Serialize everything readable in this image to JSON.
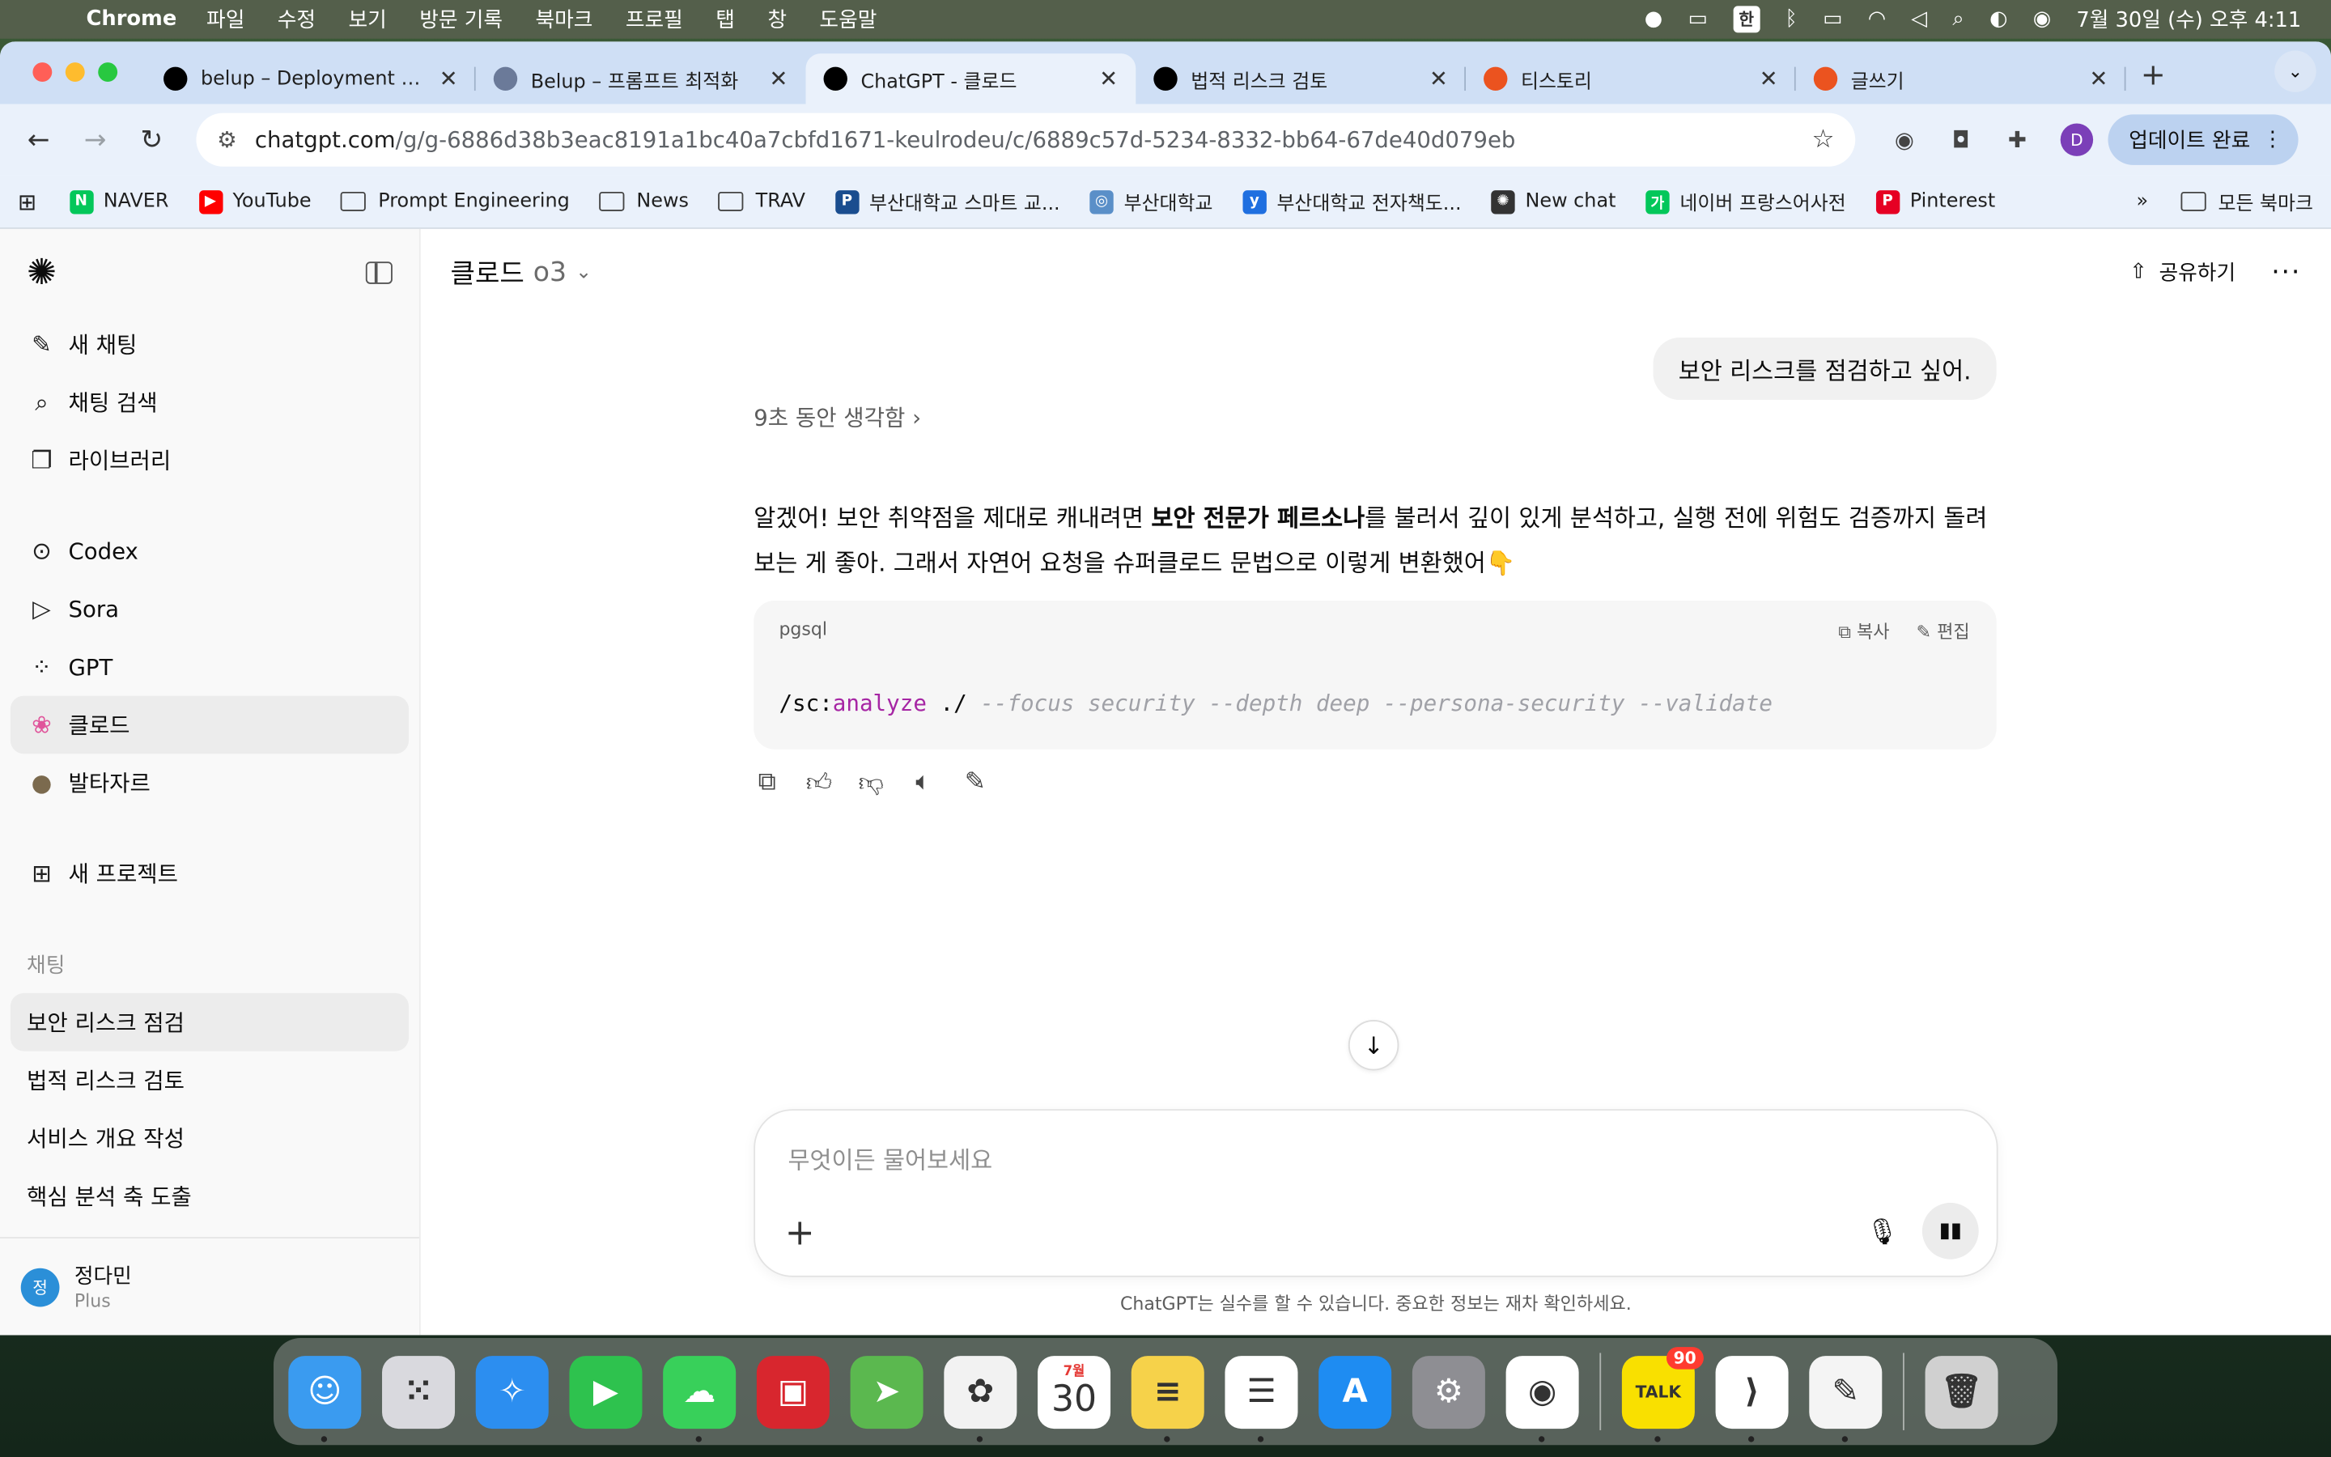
{
  "menubar": {
    "app_name": "Chrome",
    "menus": [
      "파일",
      "수정",
      "보기",
      "방문 기록",
      "북마크",
      "프로필",
      "탭",
      "창",
      "도움말"
    ],
    "input_method": "한",
    "clock": "7월 30일 (수) 오후 4:11"
  },
  "tabs": [
    {
      "title": "belup – Deployment Ov",
      "icon": "vercel-icon",
      "color": "#000000"
    },
    {
      "title": "Belup – 프롬프트 최적화",
      "icon": "belup-icon",
      "color": "#6b7a99"
    },
    {
      "title": "ChatGPT - 클로드",
      "icon": "openai-icon",
      "color": "#000000",
      "active": true
    },
    {
      "title": "법적 리스크 검토",
      "icon": "openai-icon",
      "color": "#000000"
    },
    {
      "title": "티스토리",
      "icon": "tistory-icon",
      "color": "#eb531f"
    },
    {
      "title": "글쓰기",
      "icon": "tistory-icon",
      "color": "#eb531f"
    }
  ],
  "toolbar": {
    "url_host": "chatgpt.com",
    "url_path": "/g/g-6886d38b3eac8191a1bc40a7cbfd1671-keulrodeu/c/6889c57d-5234-8332-bb64-67de40d079eb",
    "profile_initial": "D",
    "update_label": "업데이트 완료"
  },
  "bookmarks": [
    {
      "label": "NAVER",
      "type": "site",
      "color": "#03c75a",
      "glyph": "N"
    },
    {
      "label": "YouTube",
      "type": "site",
      "color": "#ff0000",
      "glyph": "▶"
    },
    {
      "label": "Prompt Engineering",
      "type": "folder"
    },
    {
      "label": "News",
      "type": "folder"
    },
    {
      "label": "TRAV",
      "type": "folder"
    },
    {
      "label": "부산대학교 스마트 교...",
      "type": "site",
      "color": "#1a4d8f",
      "glyph": "P"
    },
    {
      "label": "부산대학교",
      "type": "site",
      "color": "#5a8fc8",
      "glyph": "◎"
    },
    {
      "label": "부산대학교 전자책도...",
      "type": "site",
      "color": "#1f6fe0",
      "glyph": "y"
    },
    {
      "label": "New chat",
      "type": "site",
      "color": "#333333",
      "glyph": "✺"
    },
    {
      "label": "네이버 프랑스어사전",
      "type": "site",
      "color": "#03c75a",
      "glyph": "가"
    },
    {
      "label": "Pinterest",
      "type": "site",
      "color": "#e60023",
      "glyph": "P"
    }
  ],
  "bookmarks_all": "모든 북마크",
  "sidebar": {
    "actions": [
      {
        "label": "새 채팅",
        "icon": "pencil-square-icon",
        "glyph": "✎"
      },
      {
        "label": "채팅 검색",
        "icon": "search-icon",
        "glyph": "⌕"
      },
      {
        "label": "라이브러리",
        "icon": "library-icon",
        "glyph": "❐"
      }
    ],
    "gpts": [
      {
        "label": "Codex",
        "icon": "codex-icon",
        "glyph": "⊙"
      },
      {
        "label": "Sora",
        "icon": "sora-icon",
        "glyph": "▷"
      },
      {
        "label": "GPT",
        "icon": "gpt-grid-icon",
        "glyph": "⁘"
      },
      {
        "label": "클로드",
        "icon": "claude-avatar-icon",
        "glyph": "❀",
        "selected": true
      },
      {
        "label": "발타자르",
        "icon": "baltazar-avatar-icon",
        "glyph": "●"
      }
    ],
    "new_project": "새 프로젝트",
    "chats_heading": "채팅",
    "chats": [
      "보안 리스크 점검",
      "법적 리스크 검토",
      "서비스 개요 작성",
      "핵심 분석 축 도출"
    ],
    "user": {
      "name": "정다민",
      "plan": "Plus",
      "initial": "정"
    }
  },
  "main": {
    "model_name": "클로드",
    "model_version": "o3",
    "share_label": "공유하기",
    "user_message": "보안 리스크를 점검하고 싶어.",
    "thinking_label": "9초 동안 생각함",
    "answer_pre": "알겠어! 보안 취약점을 제대로 캐내려면 ",
    "answer_bold": "보안 전문가 페르소나",
    "answer_post": "를 불러서 깊이 있게 분석하고, 실행 전에 위험도 검증까지 돌려보는 게 좋아. 그래서 자연어 요청을 슈퍼클로드 문법으로 이렇게 변환했어👇",
    "code": {
      "language": "pgsql",
      "copy_label": "복사",
      "edit_label": "편집",
      "cmd": "/sc:",
      "keyword": "analyze",
      "path": " ./ ",
      "flags": "--focus security --depth deep --persona-security --validate"
    },
    "composer_placeholder": "무엇이든 물어보세요",
    "disclaimer": "ChatGPT는 실수를 할 수 있습니다. 중요한 정보는 재차 확인하세요."
  },
  "dock": [
    {
      "name": "Finder",
      "color": "#3a9bf0",
      "glyph": "☺"
    },
    {
      "name": "Launchpad",
      "color": "#d9d9de",
      "glyph": "⁙"
    },
    {
      "name": "Safari",
      "color": "#2c8ef0",
      "glyph": "✧"
    },
    {
      "name": "FaceTime",
      "color": "#2ec24e",
      "glyph": "▶"
    },
    {
      "name": "Messages",
      "color": "#38d05a",
      "glyph": "☁"
    },
    {
      "name": "Photo Booth",
      "color": "#d8262e",
      "glyph": "▣"
    },
    {
      "name": "Maps",
      "color": "#5bb84f",
      "glyph": "➤"
    },
    {
      "name": "Photos",
      "color": "#f2f2f2",
      "glyph": "✿"
    },
    {
      "name": "Calendar",
      "color": "#ffffff",
      "glyph": "30",
      "month": "7월"
    },
    {
      "name": "Notes",
      "color": "#f6d24a",
      "glyph": "≡"
    },
    {
      "name": "Reminders",
      "color": "#ffffff",
      "glyph": "☰"
    },
    {
      "name": "App Store",
      "color": "#1e8cf2",
      "glyph": "A"
    },
    {
      "name": "System Settings",
      "color": "#8e8e93",
      "glyph": "⚙"
    },
    {
      "name": "Chrome",
      "color": "#ffffff",
      "glyph": "◉"
    },
    {
      "name": "KakaoTalk",
      "color": "#f9e000",
      "glyph": "TALK",
      "badge": "90"
    },
    {
      "name": "VS Code",
      "color": "#ffffff",
      "glyph": "⟩"
    },
    {
      "name": "TextEdit",
      "color": "#f4f4f4",
      "glyph": "✎"
    },
    {
      "name": "Trash",
      "color": "#d0d0d0",
      "glyph": "🗑"
    }
  ]
}
